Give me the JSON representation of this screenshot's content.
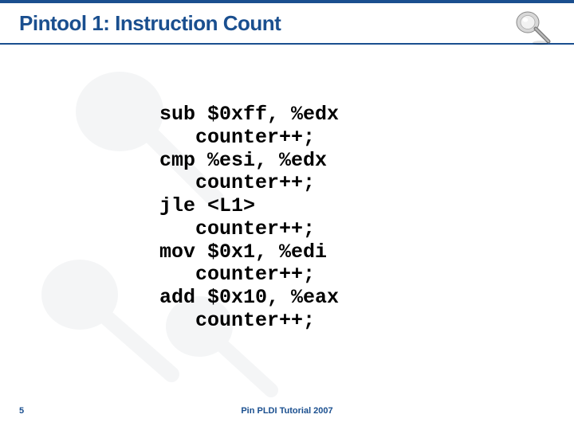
{
  "title": "Pintool 1: Instruction Count",
  "code_lines": [
    "sub $0xff, %edx",
    "   counter++;",
    "cmp %esi, %edx",
    "   counter++;",
    "jle <L1>",
    "   counter++;",
    "mov $0x1, %edi",
    "   counter++;",
    "add $0x10, %eax",
    "   counter++;"
  ],
  "page_number": "5",
  "footer": "Pin PLDI Tutorial 2007",
  "icons": {
    "corner": "pushpin-icon"
  }
}
